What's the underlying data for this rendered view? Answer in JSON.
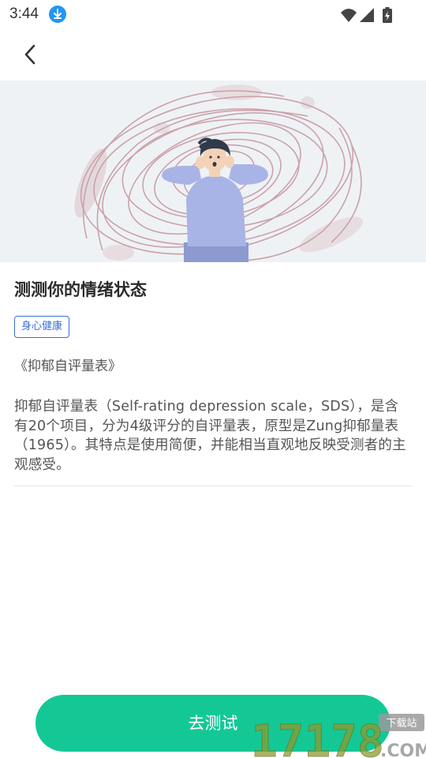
{
  "status_bar": {
    "time": "3:44",
    "icons": [
      "download-icon",
      "wifi-icon",
      "cellular-signal-icon",
      "battery-charging-icon"
    ]
  },
  "nav": {
    "back_icon": "chevron-left-icon"
  },
  "article": {
    "title": "测测你的情绪状态",
    "tag": "身心健康",
    "scale_name": "《抑郁自评量表》",
    "description": "抑郁自评量表（Self-rating depression scale，SDS），是含有20个项目，分为4级评分的自评量表，原型是Zung抑郁量表（1965）。其特点是使用简便，并能相当直观地反映受测者的主观感受。"
  },
  "action": {
    "start_label": "去测试"
  },
  "watermark": {
    "badge": "下载站",
    "digits": "17178",
    "suffix": ".COM"
  },
  "colors": {
    "accent": "#14c896",
    "tag": "#3b6fd6",
    "hero_background": "#eef2f5"
  }
}
